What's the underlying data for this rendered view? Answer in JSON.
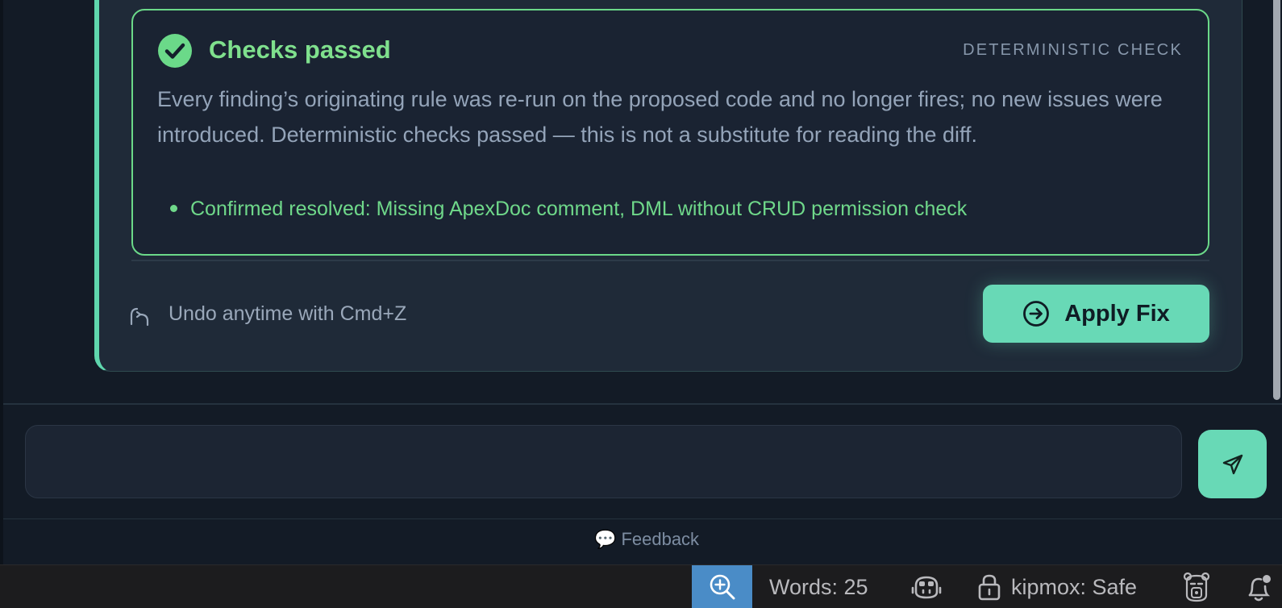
{
  "checks": {
    "title": "Checks passed",
    "label": "DETERMINISTIC CHECK",
    "description": "Every finding’s originating rule was re-run on the proposed code and no longer fires; no new issues were introduced. Deterministic checks passed — this is not a substitute for reading the diff.",
    "resolved": "Confirmed resolved: Missing ApexDoc comment, DML without CRUD permission check"
  },
  "actions": {
    "undo_hint": "Undo anytime with Cmd+Z",
    "apply_label": "Apply Fix"
  },
  "composer": {
    "value": "",
    "placeholder": ""
  },
  "feedback": {
    "label": "💬 Feedback"
  },
  "statusbar": {
    "words": "Words: 25",
    "kipmox": "kipmox: Safe"
  },
  "colors": {
    "accent": "#68d9b6",
    "success": "#6bd989",
    "zoom_bg": "#4a8cc7"
  },
  "icons": {
    "check": "check-circle-icon",
    "undo": "undo-icon",
    "apply": "arrow-circle-right-icon",
    "send": "send-icon",
    "zoom": "zoom-in-icon",
    "copilot": "copilot-icon",
    "lock": "lock-icon",
    "robot": "robot-icon",
    "bell": "bell-icon"
  }
}
